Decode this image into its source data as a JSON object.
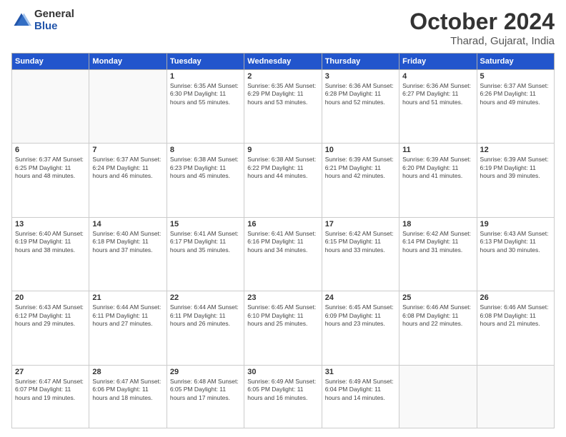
{
  "logo": {
    "general": "General",
    "blue": "Blue"
  },
  "header": {
    "month": "October 2024",
    "location": "Tharad, Gujarat, India"
  },
  "weekdays": [
    "Sunday",
    "Monday",
    "Tuesday",
    "Wednesday",
    "Thursday",
    "Friday",
    "Saturday"
  ],
  "weeks": [
    [
      {
        "day": "",
        "info": ""
      },
      {
        "day": "",
        "info": ""
      },
      {
        "day": "1",
        "info": "Sunrise: 6:35 AM\nSunset: 6:30 PM\nDaylight: 11 hours and 55 minutes."
      },
      {
        "day": "2",
        "info": "Sunrise: 6:35 AM\nSunset: 6:29 PM\nDaylight: 11 hours and 53 minutes."
      },
      {
        "day": "3",
        "info": "Sunrise: 6:36 AM\nSunset: 6:28 PM\nDaylight: 11 hours and 52 minutes."
      },
      {
        "day": "4",
        "info": "Sunrise: 6:36 AM\nSunset: 6:27 PM\nDaylight: 11 hours and 51 minutes."
      },
      {
        "day": "5",
        "info": "Sunrise: 6:37 AM\nSunset: 6:26 PM\nDaylight: 11 hours and 49 minutes."
      }
    ],
    [
      {
        "day": "6",
        "info": "Sunrise: 6:37 AM\nSunset: 6:25 PM\nDaylight: 11 hours and 48 minutes."
      },
      {
        "day": "7",
        "info": "Sunrise: 6:37 AM\nSunset: 6:24 PM\nDaylight: 11 hours and 46 minutes."
      },
      {
        "day": "8",
        "info": "Sunrise: 6:38 AM\nSunset: 6:23 PM\nDaylight: 11 hours and 45 minutes."
      },
      {
        "day": "9",
        "info": "Sunrise: 6:38 AM\nSunset: 6:22 PM\nDaylight: 11 hours and 44 minutes."
      },
      {
        "day": "10",
        "info": "Sunrise: 6:39 AM\nSunset: 6:21 PM\nDaylight: 11 hours and 42 minutes."
      },
      {
        "day": "11",
        "info": "Sunrise: 6:39 AM\nSunset: 6:20 PM\nDaylight: 11 hours and 41 minutes."
      },
      {
        "day": "12",
        "info": "Sunrise: 6:39 AM\nSunset: 6:19 PM\nDaylight: 11 hours and 39 minutes."
      }
    ],
    [
      {
        "day": "13",
        "info": "Sunrise: 6:40 AM\nSunset: 6:19 PM\nDaylight: 11 hours and 38 minutes."
      },
      {
        "day": "14",
        "info": "Sunrise: 6:40 AM\nSunset: 6:18 PM\nDaylight: 11 hours and 37 minutes."
      },
      {
        "day": "15",
        "info": "Sunrise: 6:41 AM\nSunset: 6:17 PM\nDaylight: 11 hours and 35 minutes."
      },
      {
        "day": "16",
        "info": "Sunrise: 6:41 AM\nSunset: 6:16 PM\nDaylight: 11 hours and 34 minutes."
      },
      {
        "day": "17",
        "info": "Sunrise: 6:42 AM\nSunset: 6:15 PM\nDaylight: 11 hours and 33 minutes."
      },
      {
        "day": "18",
        "info": "Sunrise: 6:42 AM\nSunset: 6:14 PM\nDaylight: 11 hours and 31 minutes."
      },
      {
        "day": "19",
        "info": "Sunrise: 6:43 AM\nSunset: 6:13 PM\nDaylight: 11 hours and 30 minutes."
      }
    ],
    [
      {
        "day": "20",
        "info": "Sunrise: 6:43 AM\nSunset: 6:12 PM\nDaylight: 11 hours and 29 minutes."
      },
      {
        "day": "21",
        "info": "Sunrise: 6:44 AM\nSunset: 6:11 PM\nDaylight: 11 hours and 27 minutes."
      },
      {
        "day": "22",
        "info": "Sunrise: 6:44 AM\nSunset: 6:11 PM\nDaylight: 11 hours and 26 minutes."
      },
      {
        "day": "23",
        "info": "Sunrise: 6:45 AM\nSunset: 6:10 PM\nDaylight: 11 hours and 25 minutes."
      },
      {
        "day": "24",
        "info": "Sunrise: 6:45 AM\nSunset: 6:09 PM\nDaylight: 11 hours and 23 minutes."
      },
      {
        "day": "25",
        "info": "Sunrise: 6:46 AM\nSunset: 6:08 PM\nDaylight: 11 hours and 22 minutes."
      },
      {
        "day": "26",
        "info": "Sunrise: 6:46 AM\nSunset: 6:08 PM\nDaylight: 11 hours and 21 minutes."
      }
    ],
    [
      {
        "day": "27",
        "info": "Sunrise: 6:47 AM\nSunset: 6:07 PM\nDaylight: 11 hours and 19 minutes."
      },
      {
        "day": "28",
        "info": "Sunrise: 6:47 AM\nSunset: 6:06 PM\nDaylight: 11 hours and 18 minutes."
      },
      {
        "day": "29",
        "info": "Sunrise: 6:48 AM\nSunset: 6:05 PM\nDaylight: 11 hours and 17 minutes."
      },
      {
        "day": "30",
        "info": "Sunrise: 6:49 AM\nSunset: 6:05 PM\nDaylight: 11 hours and 16 minutes."
      },
      {
        "day": "31",
        "info": "Sunrise: 6:49 AM\nSunset: 6:04 PM\nDaylight: 11 hours and 14 minutes."
      },
      {
        "day": "",
        "info": ""
      },
      {
        "day": "",
        "info": ""
      }
    ]
  ]
}
